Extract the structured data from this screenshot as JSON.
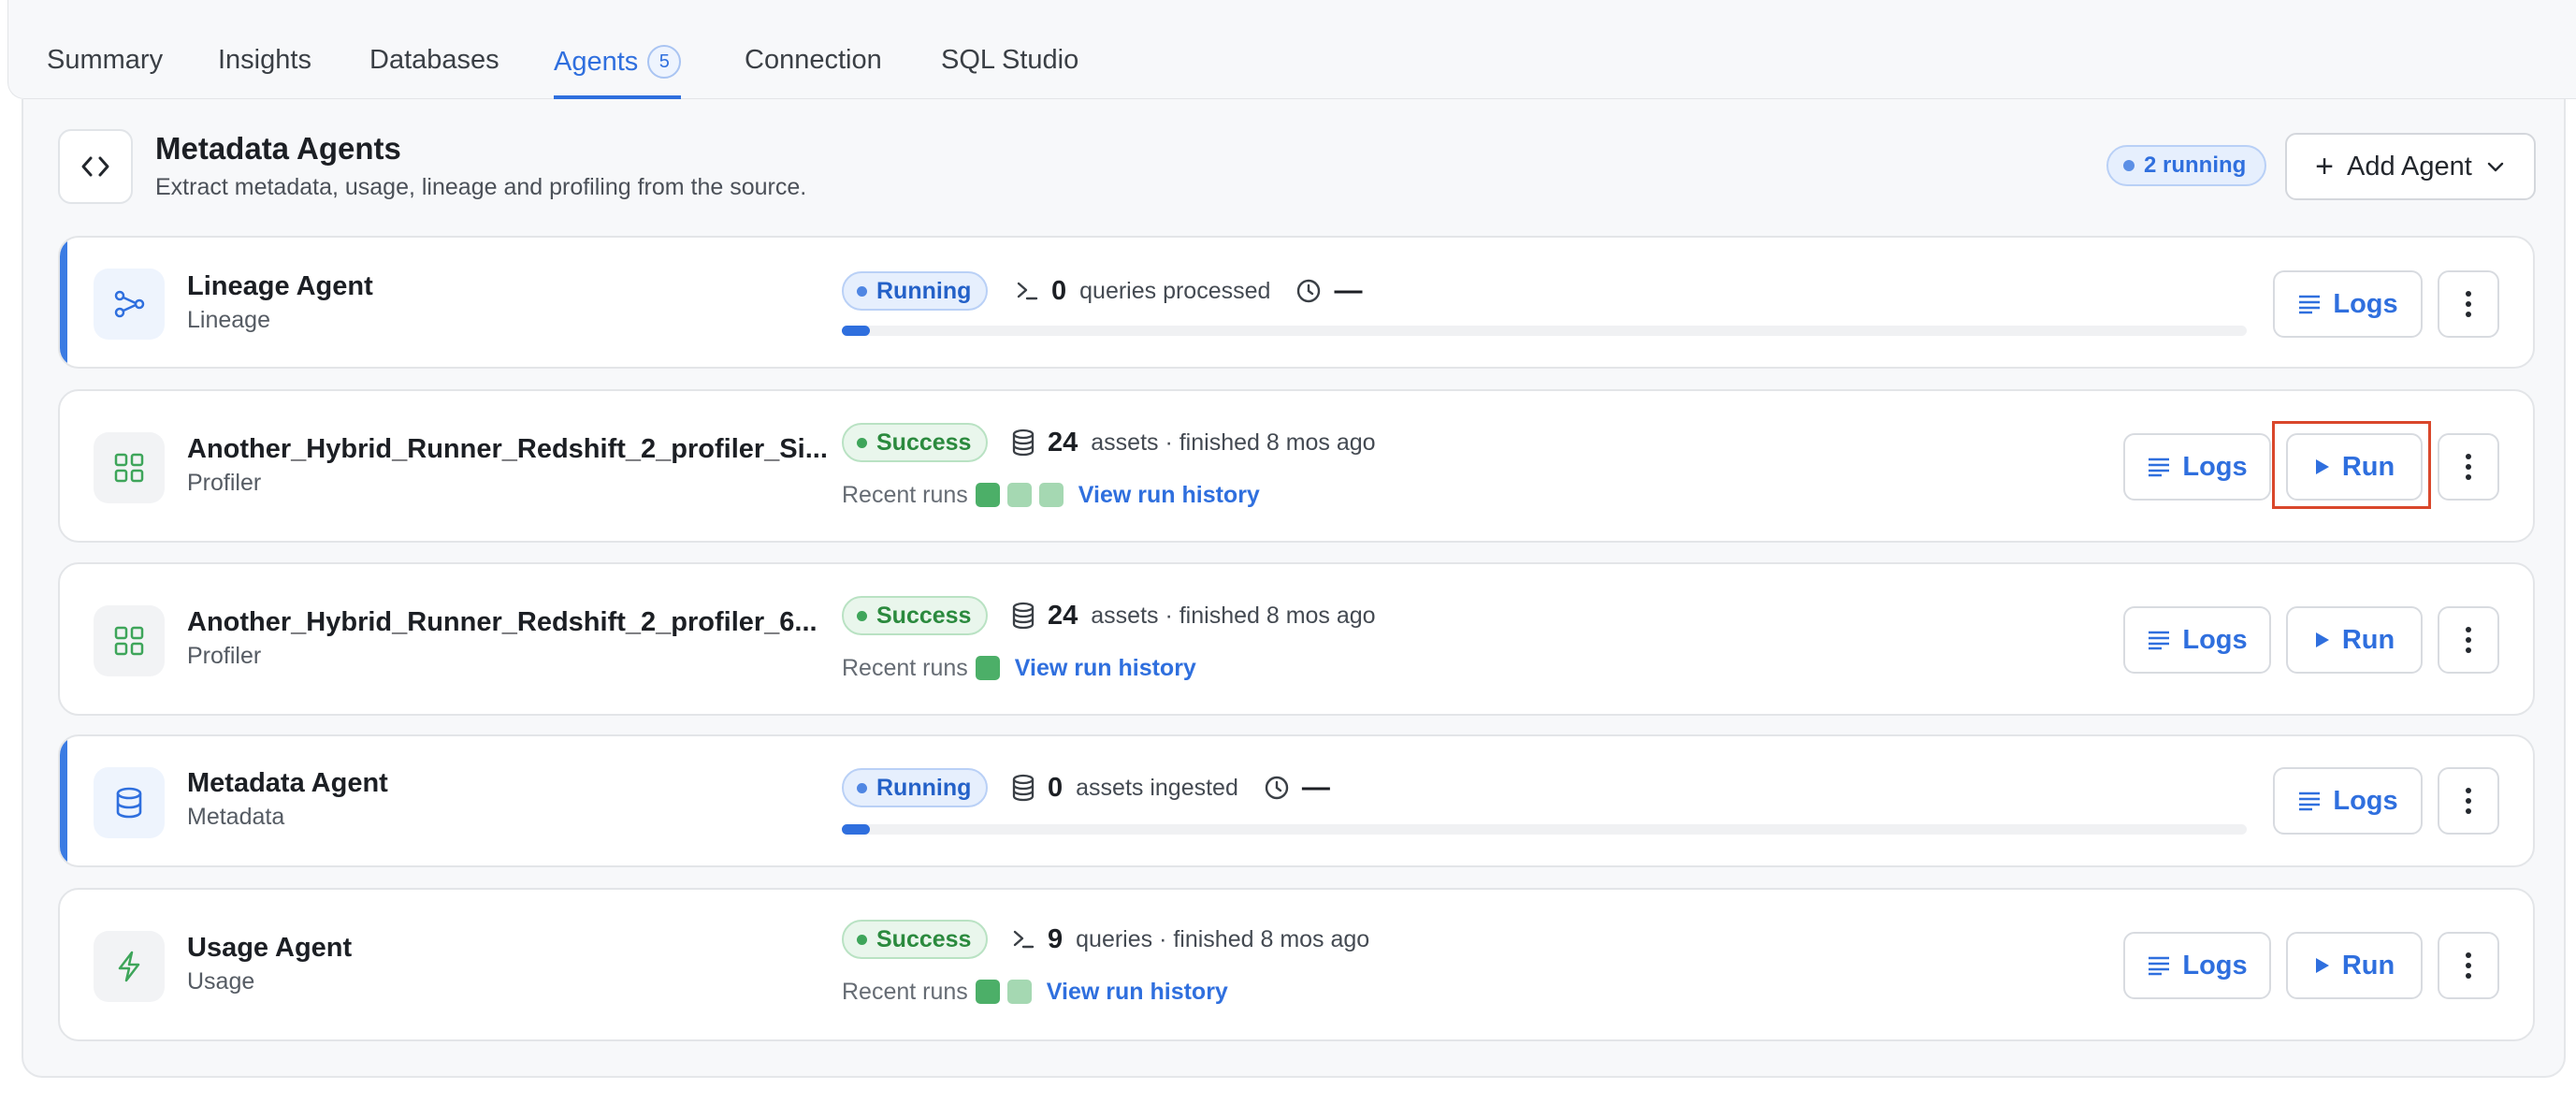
{
  "tabs": [
    {
      "label": "Summary"
    },
    {
      "label": "Insights"
    },
    {
      "label": "Databases"
    },
    {
      "label": "Agents",
      "badge": "5",
      "active": true
    },
    {
      "label": "Connection"
    },
    {
      "label": "SQL Studio"
    }
  ],
  "section": {
    "icon": "code-icon",
    "title": "Metadata Agents",
    "subtitle": "Extract metadata, usage, lineage and profiling from the source.",
    "running_label": "2 running",
    "add_agent_label": "Add Agent"
  },
  "agents": [
    {
      "name": "Lineage Agent",
      "type": "Lineage",
      "icon": "lineage-icon",
      "status": "Running",
      "count": "0",
      "metric_label": "queries processed",
      "metric_icon": "terminal-icon",
      "duration": "—",
      "progress_fraction": 0.02,
      "logs_label": "Logs"
    },
    {
      "name": "Another_Hybrid_Runner_Redshift_2_profiler_Si...",
      "type": "Profiler",
      "icon": "grid-icon",
      "status": "Success",
      "count": "24",
      "metric_label": "assets · finished 8 mos ago",
      "metric_icon": "database-icon",
      "recent_label": "Recent runs",
      "history_link": "View run history",
      "recent_runs": [
        "success",
        "success-light",
        "success-light"
      ],
      "logs_label": "Logs",
      "run_label": "Run"
    },
    {
      "name": "Another_Hybrid_Runner_Redshift_2_profiler_6...",
      "type": "Profiler",
      "icon": "grid-icon",
      "status": "Success",
      "count": "24",
      "metric_label": "assets · finished 8 mos ago",
      "metric_icon": "database-icon",
      "recent_label": "Recent runs",
      "history_link": "View run history",
      "recent_runs": [
        "success"
      ],
      "logs_label": "Logs",
      "run_label": "Run"
    },
    {
      "name": "Metadata Agent",
      "type": "Metadata",
      "icon": "database-icon",
      "status": "Running",
      "count": "0",
      "metric_label": "assets ingested",
      "metric_icon": "database-icon",
      "duration": "—",
      "progress_fraction": 0.02,
      "logs_label": "Logs"
    },
    {
      "name": "Usage Agent",
      "type": "Usage",
      "icon": "lightning-icon",
      "status": "Success",
      "count": "9",
      "metric_label": "queries · finished 8 mos ago",
      "metric_icon": "terminal-icon",
      "recent_label": "Recent runs",
      "history_link": "View run history",
      "recent_runs": [
        "success",
        "success-light"
      ],
      "logs_label": "Logs",
      "run_label": "Run"
    }
  ],
  "colors": {
    "accent": "#2f6fde",
    "running": "#4f86e3",
    "success": "#3ea55a",
    "success_run": "#4caf68",
    "success_run_light": "#a5d8b2",
    "highlight": "#d9472b"
  }
}
